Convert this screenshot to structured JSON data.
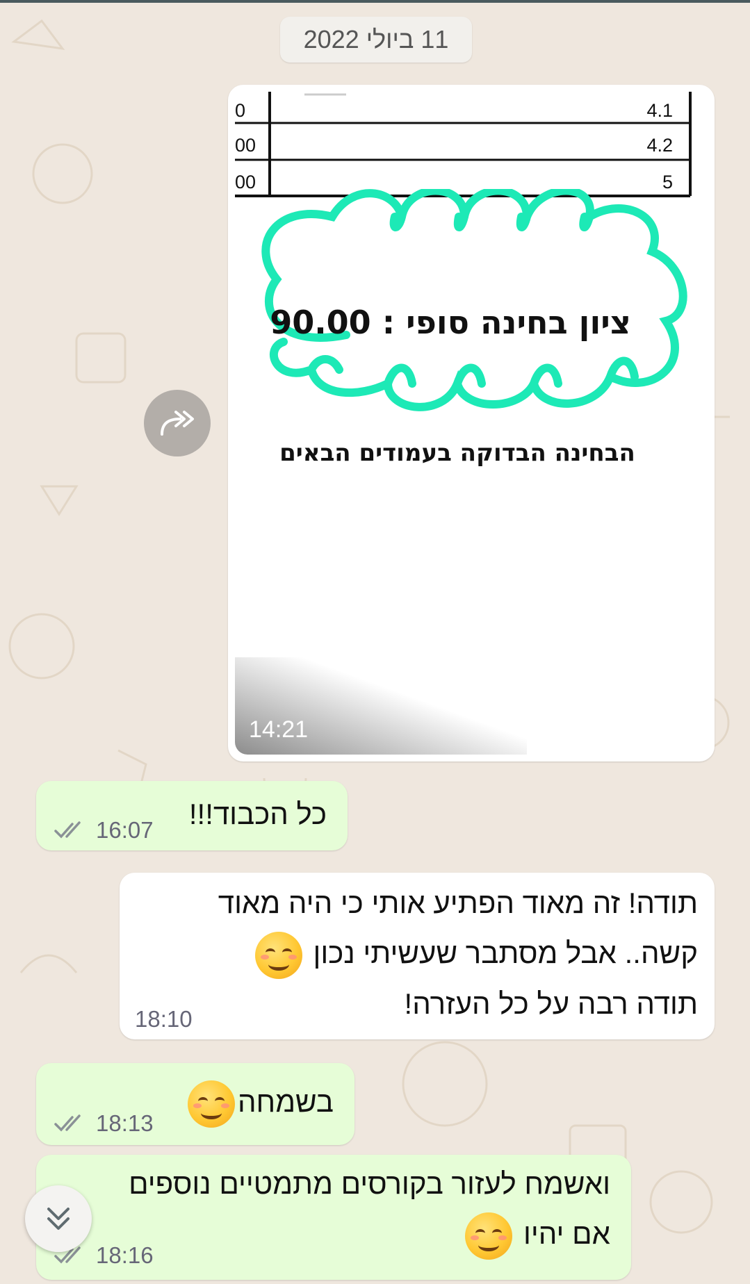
{
  "date_separator": "11 ביולי 2022",
  "image_message": {
    "table_rows": [
      {
        "left": "0",
        "right": "4.1"
      },
      {
        "left": "00",
        "right": "4.2"
      },
      {
        "left": "00",
        "right": "5"
      }
    ],
    "final_grade_text": "ציון בחינה סופי : 90.00",
    "exam_note": "הבחינה הבדוקה בעמודים הבאים",
    "time": "14:21"
  },
  "messages": [
    {
      "id": "m1",
      "text": "כל הכבוד!!!",
      "time": "16:07",
      "direction": "outgoing",
      "status": "read"
    },
    {
      "id": "m2",
      "lines": [
        "תודה! זה מאוד הפתיע אותי כי היה מאוד",
        "קשה.. אבל מסתבר שעשיתי נכון",
        "תודה רבה על כל העזרה!"
      ],
      "time": "18:10",
      "direction": "incoming"
    },
    {
      "id": "m3",
      "text": "בשמחה",
      "time": "18:13",
      "direction": "outgoing",
      "status": "read"
    },
    {
      "id": "m4",
      "lines": [
        "ואשמח לעזור בקורסים מתמטיים נוספים",
        "אם יהיו"
      ],
      "time": "18:16",
      "direction": "outgoing",
      "status": "read"
    }
  ],
  "icons": {
    "forward": "forward-icon",
    "scroll_down": "double-chevron-down-icon",
    "read_receipt": "double-check-icon",
    "emoji": "smiling-face-emoji"
  },
  "colors": {
    "wallpaper": "#efe7de",
    "incoming_bubble": "#ffffff",
    "outgoing_bubble": "#e6fdd7",
    "highlight_scribble": "#1de9b6",
    "tick_gray": "#8a9196"
  }
}
